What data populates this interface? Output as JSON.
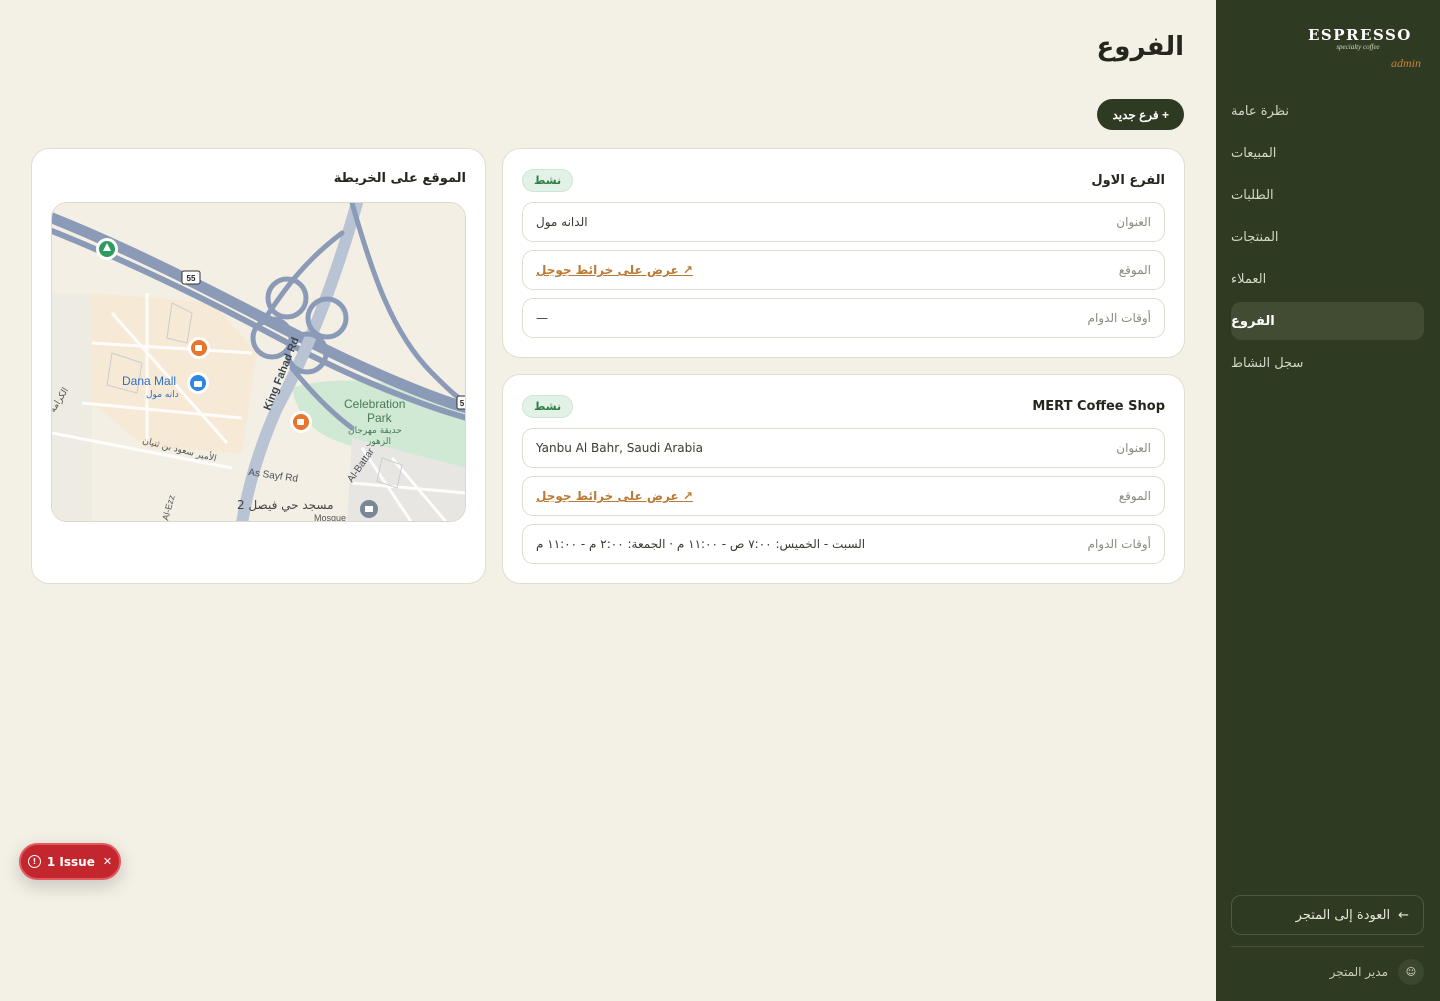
{
  "brand": {
    "name": "ESPRESSO",
    "tagline": "specialty coffee",
    "role": "admin"
  },
  "sidebar": {
    "items": [
      {
        "label": "نظرة عامة",
        "active": false
      },
      {
        "label": "المبيعات",
        "active": false
      },
      {
        "label": "الطلبات",
        "active": false
      },
      {
        "label": "المنتجات",
        "active": false
      },
      {
        "label": "العملاء",
        "active": false
      },
      {
        "label": "الفروع",
        "active": true
      },
      {
        "label": "سجل النشاط",
        "active": false
      }
    ],
    "back_label": "العودة إلى المتجر",
    "back_icon": "←",
    "user_label": "مدير المتجر",
    "user_icon": "☺"
  },
  "page": {
    "title": "الفروع",
    "new_button": "+ فرع جديد"
  },
  "branches": [
    {
      "name": "الفرع الاول",
      "status": "نشط",
      "address_label": "العنوان",
      "address": "الدانه مول",
      "location_label": "الموقع",
      "location_link": "عرض على خرائط جوجل ↗",
      "hours_label": "أوقات الدوام",
      "hours": "—"
    },
    {
      "name": "MERT Coffee Shop",
      "status": "نشط",
      "address_label": "العنوان",
      "address": "Yanbu Al Bahr, Saudi Arabia",
      "location_label": "الموقع",
      "location_link": "عرض على خرائط جوجل ↗",
      "hours_label": "أوقات الدوام",
      "hours": "السبت - الخميس: ٧:٠٠ ص - ١١:٠٠ م · الجمعة: ٢:٠٠ م - ١١:٠٠ م"
    }
  ],
  "map": {
    "title": "الموقع على الخريطة",
    "labels": {
      "dana_mall": "Dana Mall",
      "dana_mall_ar": "دانه مول",
      "celebration_park": "Celebration",
      "celebration_park_2": "Park",
      "celebration_park_ar": "حديقة مهرجان",
      "celebration_park_ar_2": "الزهور",
      "king_fahad": "King Fahad Rd",
      "as_sayf": "As Sayf Rd",
      "al_battar": "Al-Battar",
      "mosque": "مسجد حي فيصل 2",
      "mosque_en": "Mosque",
      "prince_street": "الأمير سعود بن ثنيان",
      "karama": "الكرامة",
      "al_ezz": "Al-Ezz",
      "road_55": "55",
      "road_5": "5"
    }
  },
  "issue": {
    "label": "1 Issue",
    "icon": "!",
    "close": "✕"
  }
}
